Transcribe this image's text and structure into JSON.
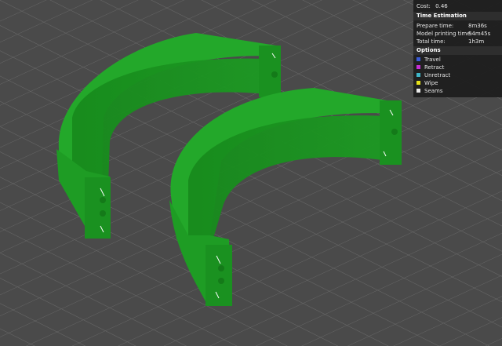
{
  "summary": {
    "cost_label": "Cost:",
    "cost_value": "0.46"
  },
  "time_estimation": {
    "title": "Time Estimation",
    "rows": [
      {
        "label": "Prepare time:",
        "value": "8m36s"
      },
      {
        "label": "Model printing time:",
        "value": "54m45s"
      },
      {
        "label": "Total time:",
        "value": "1h3m"
      }
    ]
  },
  "options": {
    "title": "Options",
    "items": [
      {
        "label": "Travel",
        "color": "#3a5bd6"
      },
      {
        "label": "Retract",
        "color": "#c62fd6"
      },
      {
        "label": "Unretract",
        "color": "#3fb6c9"
      },
      {
        "label": "Wipe",
        "color": "#e6e21a"
      },
      {
        "label": "Seams",
        "color": "#e8e8e8"
      }
    ]
  },
  "colors": {
    "model": "#1fa125",
    "background": "#4a4a4a",
    "grid": "#6a6a6a"
  }
}
